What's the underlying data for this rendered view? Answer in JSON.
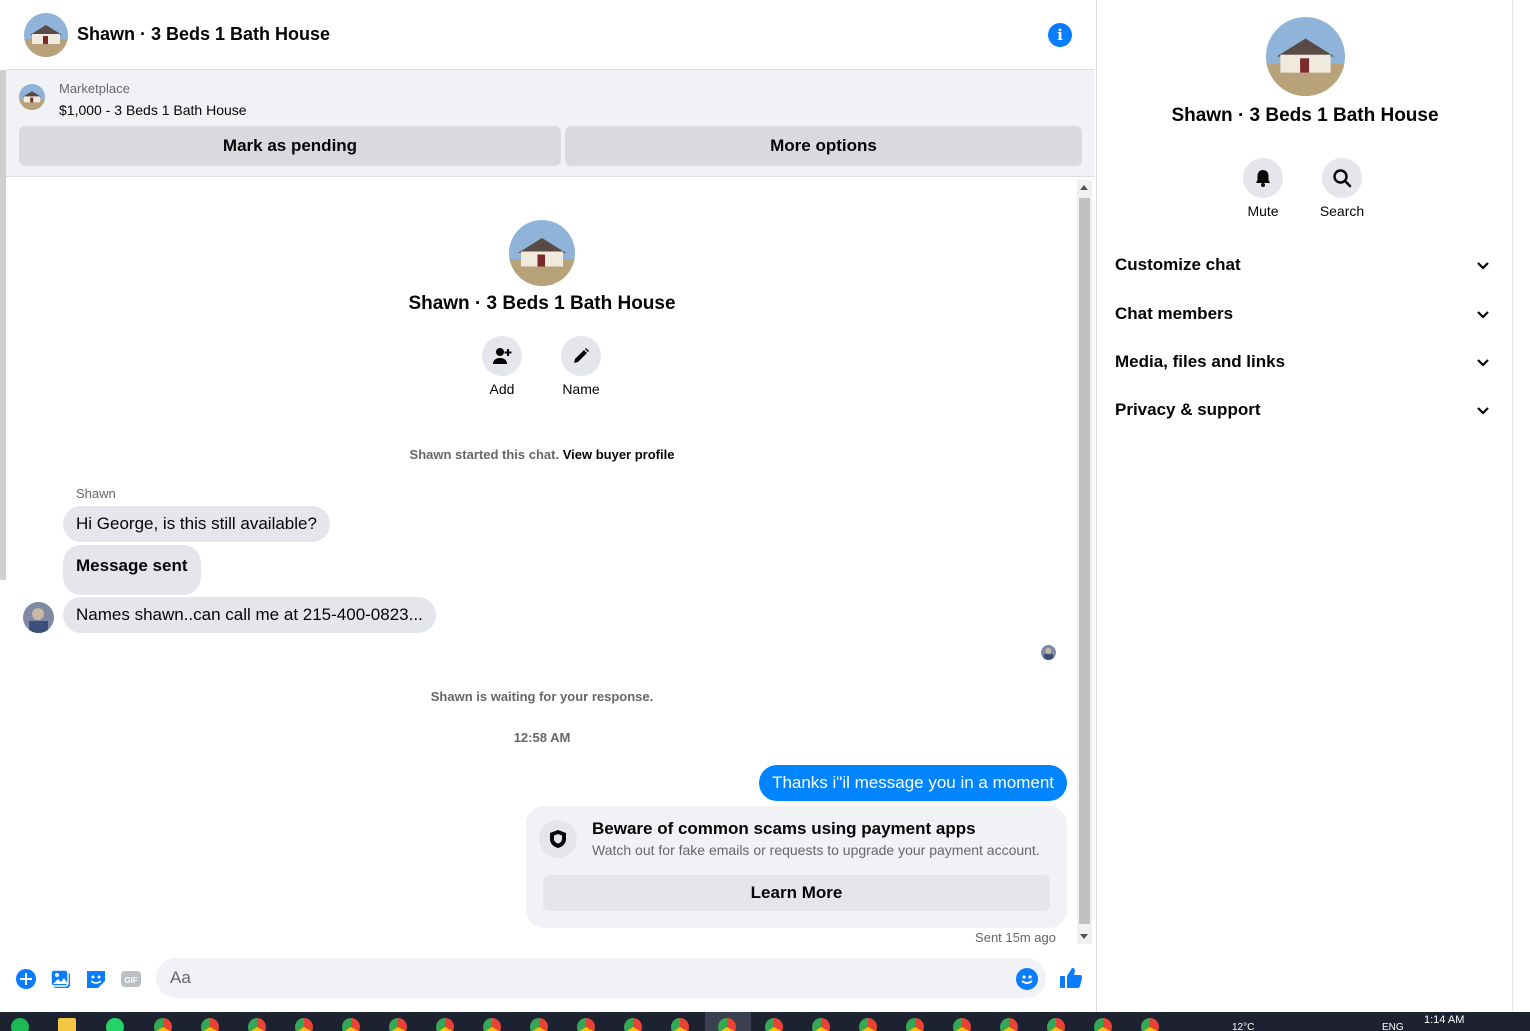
{
  "header": {
    "title": "Shawn · 3 Beds 1 Bath House",
    "info_icon": "info-icon"
  },
  "marketplace": {
    "label": "Marketplace",
    "item": "$1,000 - 3 Beds 1 Bath House",
    "mark_pending": "Mark as pending",
    "more_options": "More options"
  },
  "intro": {
    "title": "Shawn · 3 Beds 1 Bath House",
    "add_label": "Add",
    "name_label": "Name",
    "started_text": "Shawn started this chat.",
    "view_profile": "View buyer profile"
  },
  "messages": {
    "sender": "Shawn",
    "incoming": [
      "Hi George, is this still available?",
      "Message sent",
      "Names shawn..can call me at 215-400-0823..."
    ],
    "waiting": "Shawn is waiting for your response.",
    "timestamp": "12:58 AM",
    "outgoing": "Thanks i\"il message you in a moment",
    "scam_title": "Beware of common scams using payment apps",
    "scam_sub": "Watch out for fake emails or requests to upgrade your payment account.",
    "learn_more": "Learn More",
    "sent_meta": "Sent 15m ago"
  },
  "composer": {
    "placeholder": "Aa"
  },
  "right_panel": {
    "title": "Shawn · 3 Beds 1 Bath House",
    "mute_label": "Mute",
    "search_label": "Search",
    "rows": [
      "Customize chat",
      "Chat members",
      "Media, files and links",
      "Privacy & support"
    ]
  },
  "taskbar": {
    "temp": "12°C",
    "lang": "ENG",
    "time": "1:14 AM"
  },
  "colors": {
    "accent": "#0a7cff",
    "outgoing_bubble": "#0084ff",
    "panel_bg": "#f0f2f5"
  }
}
